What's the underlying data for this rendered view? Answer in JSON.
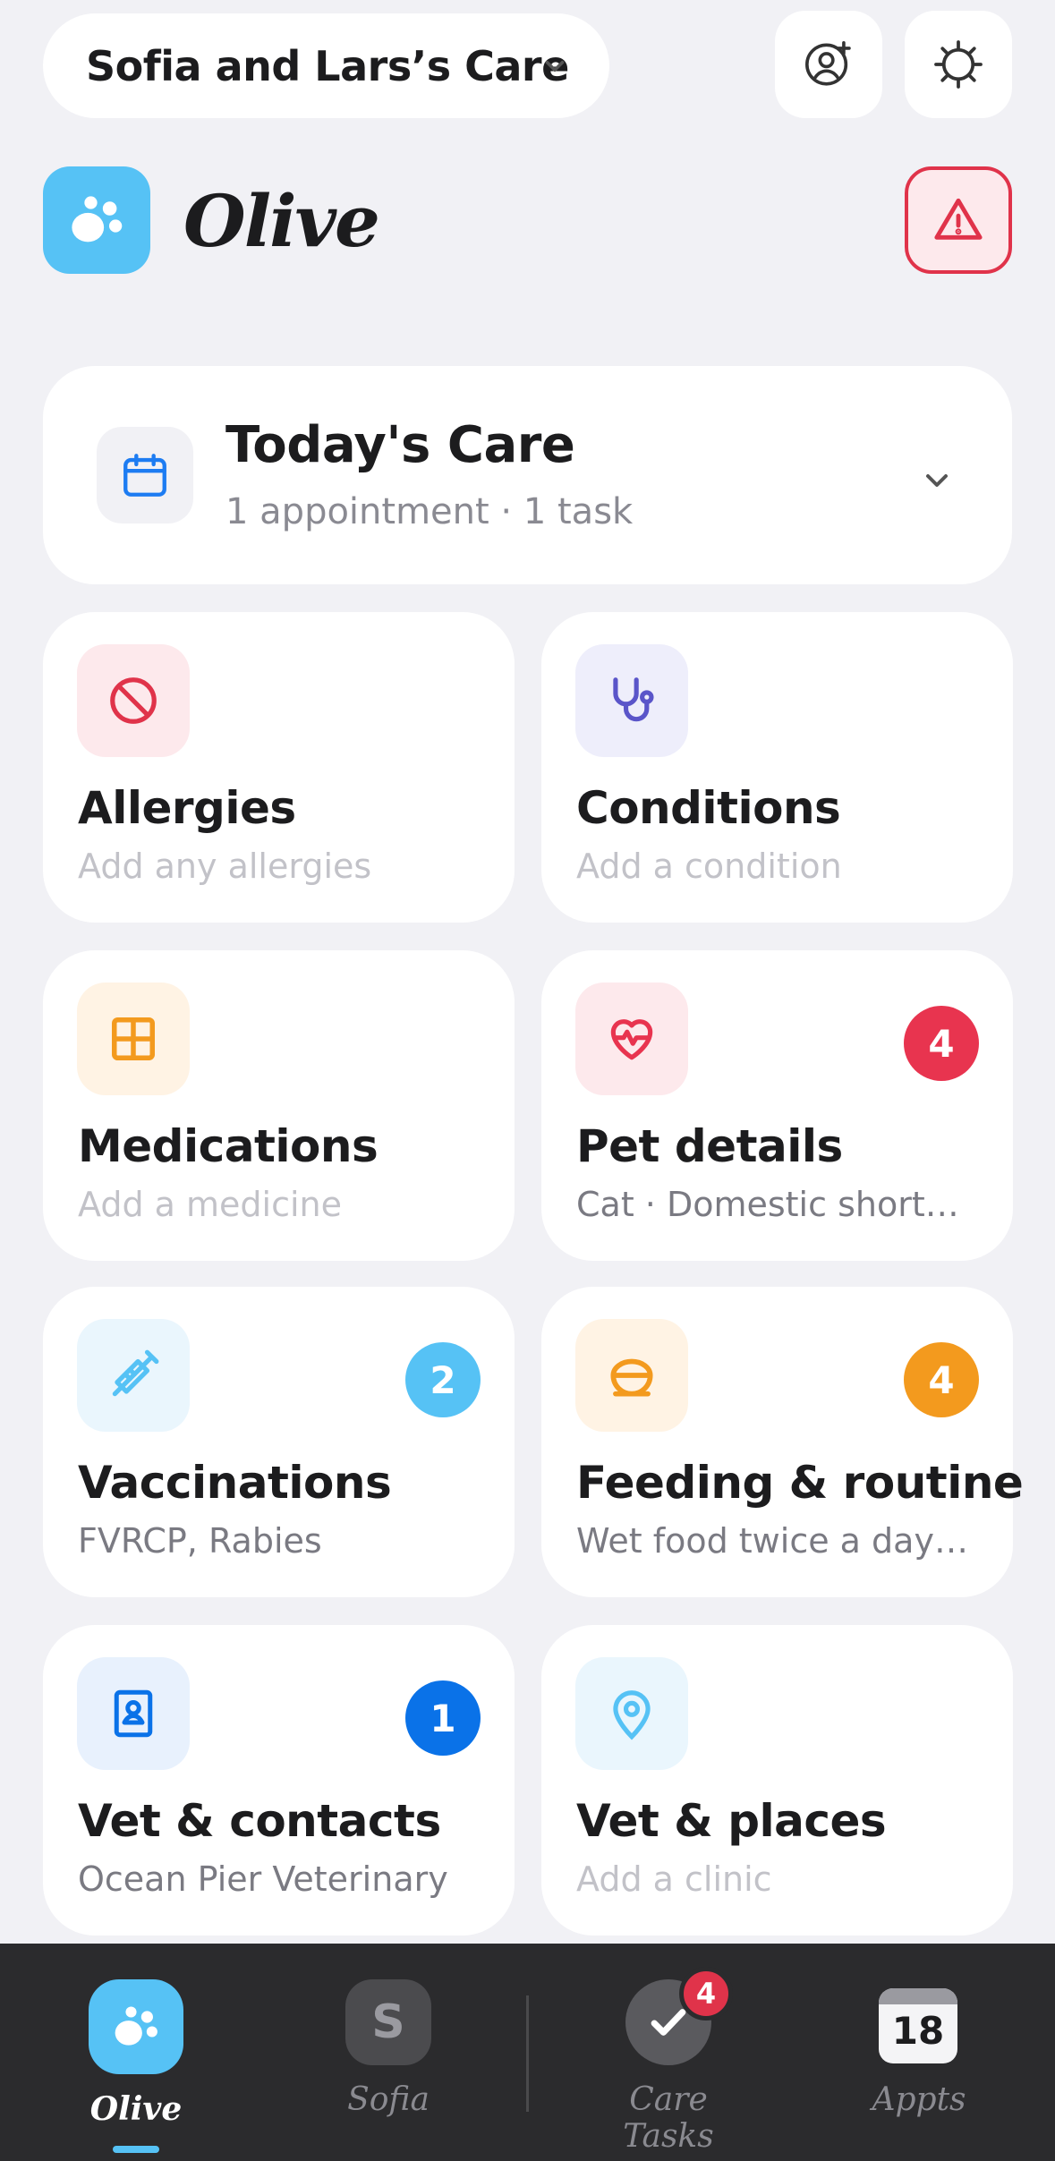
{
  "header": {
    "care_group": "Sofia and Lars’s Care",
    "add_person_icon": "person-add-icon",
    "settings_icon": "gear-icon"
  },
  "pet": {
    "name": "Olive",
    "logo_icon": "paw-icon",
    "alert_icon": "warning-triangle-icon"
  },
  "today": {
    "title": "Today's Care",
    "summary": "1 appointment · 1 task",
    "icon": "calendar-icon"
  },
  "tiles": [
    {
      "name": "Allergies",
      "desc": "Add any allergies",
      "icon": "no-entry-icon",
      "color": "#e0334a"
    },
    {
      "name": "Conditions",
      "desc": "Add a condition",
      "icon": "stethoscope-icon",
      "color": "#5a55c9"
    },
    {
      "name": "Medications",
      "desc": "Add a medicine",
      "icon": "pill-box-icon",
      "color": "#f39a1e"
    },
    {
      "name": "Pet details",
      "desc": "Cat · Domestic shorth…",
      "badge": "4",
      "icon": "heart-pulse-icon",
      "color": "#e8344f"
    },
    {
      "name": "Vaccinations",
      "desc": "FVRCP, Rabies",
      "badge": "2",
      "icon": "syringe-icon",
      "color": "#56c2f5"
    },
    {
      "name": "Feeding & routine",
      "desc": "Wet food twice a day · …",
      "badge": "4",
      "icon": "food-bowl-icon",
      "color": "#f39a1e"
    },
    {
      "name": "Vet & contacts",
      "desc": "Ocean Pier Veterinary",
      "badge": "1",
      "icon": "contact-book-icon",
      "color": "#0a72e8"
    },
    {
      "name": "Vet & places",
      "desc": "Add a clinic",
      "icon": "map-pin-icon",
      "color": "#56c2f5"
    }
  ],
  "nav": {
    "items": [
      {
        "label": "Olive",
        "icon": "paw-icon"
      },
      {
        "label": "Sofia",
        "initial": "S"
      },
      {
        "label": "Care Tasks",
        "badge": "4",
        "icon": "check-icon"
      },
      {
        "label": "Appts",
        "date": "18",
        "icon": "calendar-icon"
      }
    ]
  }
}
